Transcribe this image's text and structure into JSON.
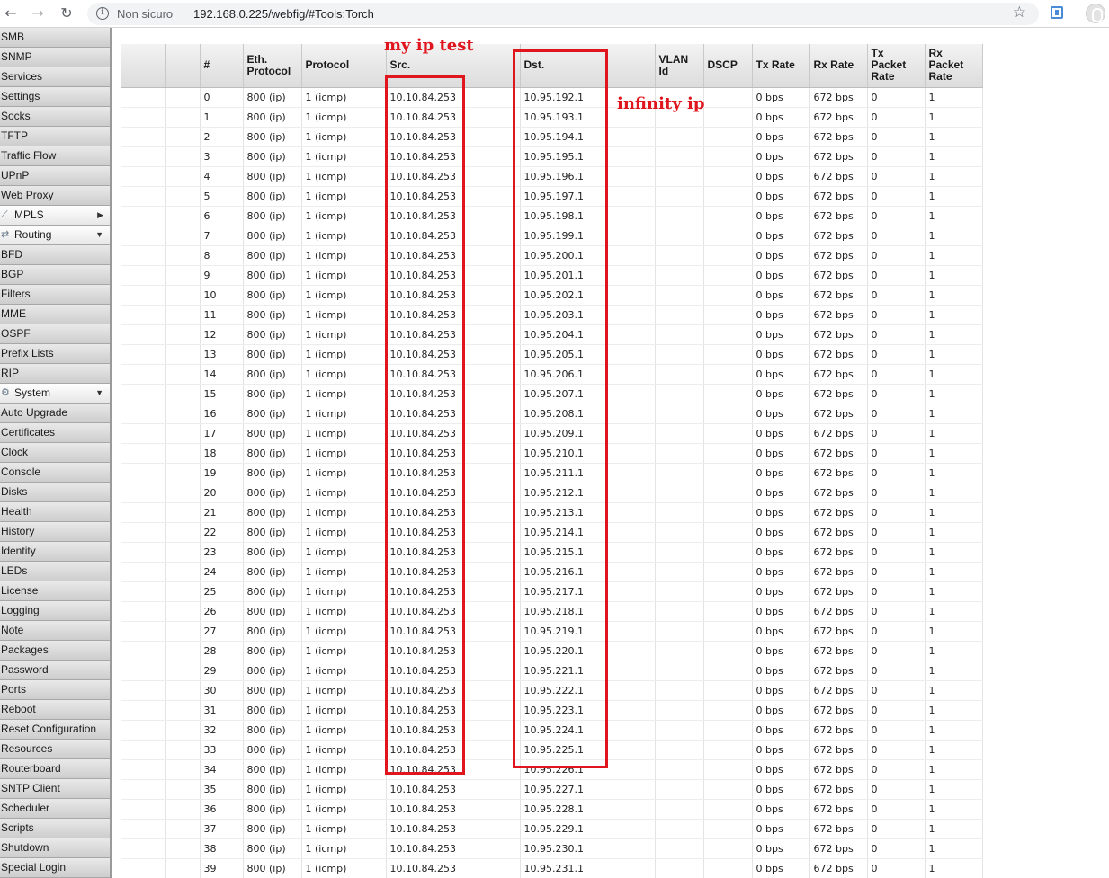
{
  "browser": {
    "security_label": "Non sicuro",
    "url": "192.168.0.225/webfig/#Tools:Torch",
    "icons": [
      "back-icon",
      "forward-icon",
      "reload-icon",
      "info-icon",
      "star-icon",
      "extension-icon",
      "profile-icon"
    ]
  },
  "sidebar": {
    "items": [
      {
        "label": "SMB"
      },
      {
        "label": "SNMP"
      },
      {
        "label": "Services"
      },
      {
        "label": "Settings"
      },
      {
        "label": "Socks"
      },
      {
        "label": "TFTP"
      },
      {
        "label": "Traffic Flow"
      },
      {
        "label": "UPnP"
      },
      {
        "label": "Web Proxy"
      },
      {
        "label": "MPLS",
        "group": true,
        "icon": "mpls-icon",
        "arrow": "▶"
      },
      {
        "label": "Routing",
        "group": true,
        "icon": "routing-icon",
        "arrow": "▼"
      },
      {
        "label": "BFD"
      },
      {
        "label": "BGP"
      },
      {
        "label": "Filters"
      },
      {
        "label": "MME"
      },
      {
        "label": "OSPF"
      },
      {
        "label": "Prefix Lists"
      },
      {
        "label": "RIP"
      },
      {
        "label": "System",
        "group": true,
        "icon": "gear-icon",
        "arrow": "▼"
      },
      {
        "label": "Auto Upgrade"
      },
      {
        "label": "Certificates"
      },
      {
        "label": "Clock"
      },
      {
        "label": "Console"
      },
      {
        "label": "Disks"
      },
      {
        "label": "Health"
      },
      {
        "label": "History"
      },
      {
        "label": "Identity"
      },
      {
        "label": "LEDs"
      },
      {
        "label": "License"
      },
      {
        "label": "Logging"
      },
      {
        "label": "Note"
      },
      {
        "label": "Packages"
      },
      {
        "label": "Password"
      },
      {
        "label": "Ports"
      },
      {
        "label": "Reboot"
      },
      {
        "label": "Reset Configuration"
      },
      {
        "label": "Resources"
      },
      {
        "label": "Routerboard"
      },
      {
        "label": "SNTP Client"
      },
      {
        "label": "Scheduler"
      },
      {
        "label": "Scripts"
      },
      {
        "label": "Shutdown"
      },
      {
        "label": "Special Login"
      }
    ]
  },
  "table": {
    "columns": [
      "",
      "",
      "#",
      "Eth. Protocol",
      "Protocol",
      "Src.",
      "Dst.",
      "VLAN Id",
      "DSCP",
      "Tx Rate",
      "Rx Rate",
      "Tx Packet Rate",
      "Rx Packet Rate"
    ],
    "rows": [
      [
        "0",
        "800 (ip)",
        "1 (icmp)",
        "10.10.84.253",
        "10.95.192.1",
        "",
        "",
        "0 bps",
        "672 bps",
        "0",
        "1"
      ],
      [
        "1",
        "800 (ip)",
        "1 (icmp)",
        "10.10.84.253",
        "10.95.193.1",
        "",
        "",
        "0 bps",
        "672 bps",
        "0",
        "1"
      ],
      [
        "2",
        "800 (ip)",
        "1 (icmp)",
        "10.10.84.253",
        "10.95.194.1",
        "",
        "",
        "0 bps",
        "672 bps",
        "0",
        "1"
      ],
      [
        "3",
        "800 (ip)",
        "1 (icmp)",
        "10.10.84.253",
        "10.95.195.1",
        "",
        "",
        "0 bps",
        "672 bps",
        "0",
        "1"
      ],
      [
        "4",
        "800 (ip)",
        "1 (icmp)",
        "10.10.84.253",
        "10.95.196.1",
        "",
        "",
        "0 bps",
        "672 bps",
        "0",
        "1"
      ],
      [
        "5",
        "800 (ip)",
        "1 (icmp)",
        "10.10.84.253",
        "10.95.197.1",
        "",
        "",
        "0 bps",
        "672 bps",
        "0",
        "1"
      ],
      [
        "6",
        "800 (ip)",
        "1 (icmp)",
        "10.10.84.253",
        "10.95.198.1",
        "",
        "",
        "0 bps",
        "672 bps",
        "0",
        "1"
      ],
      [
        "7",
        "800 (ip)",
        "1 (icmp)",
        "10.10.84.253",
        "10.95.199.1",
        "",
        "",
        "0 bps",
        "672 bps",
        "0",
        "1"
      ],
      [
        "8",
        "800 (ip)",
        "1 (icmp)",
        "10.10.84.253",
        "10.95.200.1",
        "",
        "",
        "0 bps",
        "672 bps",
        "0",
        "1"
      ],
      [
        "9",
        "800 (ip)",
        "1 (icmp)",
        "10.10.84.253",
        "10.95.201.1",
        "",
        "",
        "0 bps",
        "672 bps",
        "0",
        "1"
      ],
      [
        "10",
        "800 (ip)",
        "1 (icmp)",
        "10.10.84.253",
        "10.95.202.1",
        "",
        "",
        "0 bps",
        "672 bps",
        "0",
        "1"
      ],
      [
        "11",
        "800 (ip)",
        "1 (icmp)",
        "10.10.84.253",
        "10.95.203.1",
        "",
        "",
        "0 bps",
        "672 bps",
        "0",
        "1"
      ],
      [
        "12",
        "800 (ip)",
        "1 (icmp)",
        "10.10.84.253",
        "10.95.204.1",
        "",
        "",
        "0 bps",
        "672 bps",
        "0",
        "1"
      ],
      [
        "13",
        "800 (ip)",
        "1 (icmp)",
        "10.10.84.253",
        "10.95.205.1",
        "",
        "",
        "0 bps",
        "672 bps",
        "0",
        "1"
      ],
      [
        "14",
        "800 (ip)",
        "1 (icmp)",
        "10.10.84.253",
        "10.95.206.1",
        "",
        "",
        "0 bps",
        "672 bps",
        "0",
        "1"
      ],
      [
        "15",
        "800 (ip)",
        "1 (icmp)",
        "10.10.84.253",
        "10.95.207.1",
        "",
        "",
        "0 bps",
        "672 bps",
        "0",
        "1"
      ],
      [
        "16",
        "800 (ip)",
        "1 (icmp)",
        "10.10.84.253",
        "10.95.208.1",
        "",
        "",
        "0 bps",
        "672 bps",
        "0",
        "1"
      ],
      [
        "17",
        "800 (ip)",
        "1 (icmp)",
        "10.10.84.253",
        "10.95.209.1",
        "",
        "",
        "0 bps",
        "672 bps",
        "0",
        "1"
      ],
      [
        "18",
        "800 (ip)",
        "1 (icmp)",
        "10.10.84.253",
        "10.95.210.1",
        "",
        "",
        "0 bps",
        "672 bps",
        "0",
        "1"
      ],
      [
        "19",
        "800 (ip)",
        "1 (icmp)",
        "10.10.84.253",
        "10.95.211.1",
        "",
        "",
        "0 bps",
        "672 bps",
        "0",
        "1"
      ],
      [
        "20",
        "800 (ip)",
        "1 (icmp)",
        "10.10.84.253",
        "10.95.212.1",
        "",
        "",
        "0 bps",
        "672 bps",
        "0",
        "1"
      ],
      [
        "21",
        "800 (ip)",
        "1 (icmp)",
        "10.10.84.253",
        "10.95.213.1",
        "",
        "",
        "0 bps",
        "672 bps",
        "0",
        "1"
      ],
      [
        "22",
        "800 (ip)",
        "1 (icmp)",
        "10.10.84.253",
        "10.95.214.1",
        "",
        "",
        "0 bps",
        "672 bps",
        "0",
        "1"
      ],
      [
        "23",
        "800 (ip)",
        "1 (icmp)",
        "10.10.84.253",
        "10.95.215.1",
        "",
        "",
        "0 bps",
        "672 bps",
        "0",
        "1"
      ],
      [
        "24",
        "800 (ip)",
        "1 (icmp)",
        "10.10.84.253",
        "10.95.216.1",
        "",
        "",
        "0 bps",
        "672 bps",
        "0",
        "1"
      ],
      [
        "25",
        "800 (ip)",
        "1 (icmp)",
        "10.10.84.253",
        "10.95.217.1",
        "",
        "",
        "0 bps",
        "672 bps",
        "0",
        "1"
      ],
      [
        "26",
        "800 (ip)",
        "1 (icmp)",
        "10.10.84.253",
        "10.95.218.1",
        "",
        "",
        "0 bps",
        "672 bps",
        "0",
        "1"
      ],
      [
        "27",
        "800 (ip)",
        "1 (icmp)",
        "10.10.84.253",
        "10.95.219.1",
        "",
        "",
        "0 bps",
        "672 bps",
        "0",
        "1"
      ],
      [
        "28",
        "800 (ip)",
        "1 (icmp)",
        "10.10.84.253",
        "10.95.220.1",
        "",
        "",
        "0 bps",
        "672 bps",
        "0",
        "1"
      ],
      [
        "29",
        "800 (ip)",
        "1 (icmp)",
        "10.10.84.253",
        "10.95.221.1",
        "",
        "",
        "0 bps",
        "672 bps",
        "0",
        "1"
      ],
      [
        "30",
        "800 (ip)",
        "1 (icmp)",
        "10.10.84.253",
        "10.95.222.1",
        "",
        "",
        "0 bps",
        "672 bps",
        "0",
        "1"
      ],
      [
        "31",
        "800 (ip)",
        "1 (icmp)",
        "10.10.84.253",
        "10.95.223.1",
        "",
        "",
        "0 bps",
        "672 bps",
        "0",
        "1"
      ],
      [
        "32",
        "800 (ip)",
        "1 (icmp)",
        "10.10.84.253",
        "10.95.224.1",
        "",
        "",
        "0 bps",
        "672 bps",
        "0",
        "1"
      ],
      [
        "33",
        "800 (ip)",
        "1 (icmp)",
        "10.10.84.253",
        "10.95.225.1",
        "",
        "",
        "0 bps",
        "672 bps",
        "0",
        "1"
      ],
      [
        "34",
        "800 (ip)",
        "1 (icmp)",
        "10.10.84.253",
        "10.95.226.1",
        "",
        "",
        "0 bps",
        "672 bps",
        "0",
        "1"
      ],
      [
        "35",
        "800 (ip)",
        "1 (icmp)",
        "10.10.84.253",
        "10.95.227.1",
        "",
        "",
        "0 bps",
        "672 bps",
        "0",
        "1"
      ],
      [
        "36",
        "800 (ip)",
        "1 (icmp)",
        "10.10.84.253",
        "10.95.228.1",
        "",
        "",
        "0 bps",
        "672 bps",
        "0",
        "1"
      ],
      [
        "37",
        "800 (ip)",
        "1 (icmp)",
        "10.10.84.253",
        "10.95.229.1",
        "",
        "",
        "0 bps",
        "672 bps",
        "0",
        "1"
      ],
      [
        "38",
        "800 (ip)",
        "1 (icmp)",
        "10.10.84.253",
        "10.95.230.1",
        "",
        "",
        "0 bps",
        "672 bps",
        "0",
        "1"
      ],
      [
        "39",
        "800 (ip)",
        "1 (icmp)",
        "10.10.84.253",
        "10.95.231.1",
        "",
        "",
        "0 bps",
        "672 bps",
        "0",
        "1"
      ]
    ]
  },
  "annotations": {
    "src_note": "my ip test",
    "dst_note": "infinity ip",
    "color": "#e0161e"
  }
}
